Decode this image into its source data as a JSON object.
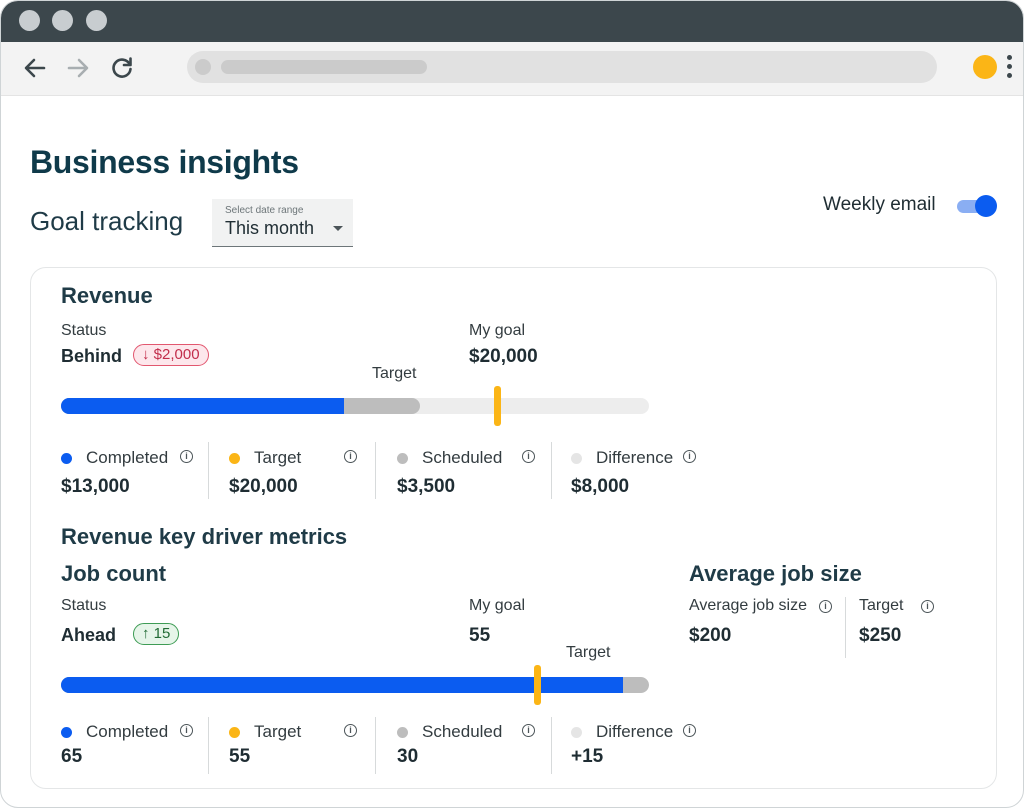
{
  "colors": {
    "completed": "#0b5cf0",
    "target": "#fbb516",
    "scheduled": "#bdbdbd",
    "difference": "#e5e5e5",
    "behind": "#c22d4b",
    "ahead": "#226b35"
  },
  "browser": {
    "back_icon": "arrow-left-icon",
    "forward_icon": "arrow-right-icon",
    "reload_icon": "reload-icon",
    "menu_icon": "kebab-menu-icon"
  },
  "page": {
    "title": "Business insights",
    "section_title": "Goal tracking",
    "date_range": {
      "label": "Select date range",
      "value": "This month"
    },
    "weekly_email": {
      "label": "Weekly email",
      "enabled": true
    }
  },
  "revenue": {
    "title": "Revenue",
    "status_label": "Status",
    "status_value": "Behind",
    "status_delta": "↓ $2,000",
    "goal_label": "My goal",
    "goal_value": "$20,000",
    "target_label": "Target",
    "progress": {
      "completed": 13000,
      "scheduled": 3500,
      "target": 20000,
      "max": 27000
    },
    "legend": [
      {
        "label": "Completed",
        "value": "$13,000"
      },
      {
        "label": "Target",
        "value": "$20,000"
      },
      {
        "label": "Scheduled",
        "value": "$3,500"
      },
      {
        "label": "Difference",
        "value": "$8,000"
      }
    ]
  },
  "drivers": {
    "title": "Revenue key driver metrics",
    "job_count": {
      "title": "Job count",
      "status_label": "Status",
      "status_value": "Ahead",
      "status_delta": "↑ 15",
      "goal_label": "My goal",
      "goal_value": "55",
      "target_label": "Target",
      "progress": {
        "completed": 65,
        "scheduled": 3,
        "target": 55,
        "max": 68
      },
      "legend": [
        {
          "label": "Completed",
          "value": "65"
        },
        {
          "label": "Target",
          "value": "55"
        },
        {
          "label": "Scheduled",
          "value": "30"
        },
        {
          "label": "Difference",
          "value": "+15"
        }
      ]
    },
    "average_job_size": {
      "title": "Average job size",
      "metrics": [
        {
          "label": "Average job size",
          "value": "$200"
        },
        {
          "label": "Target",
          "value": "$250"
        }
      ]
    }
  }
}
